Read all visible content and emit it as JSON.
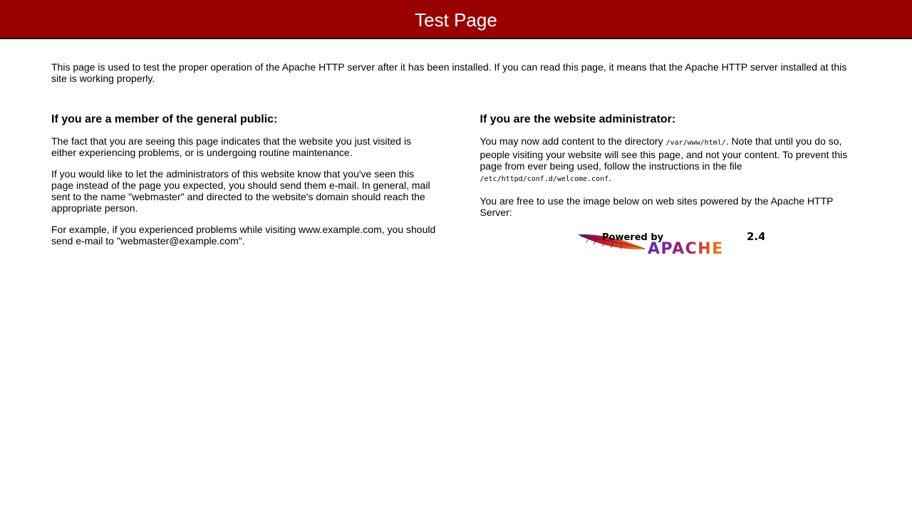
{
  "header": {
    "title": "Test Page"
  },
  "intro": "This page is used to test the proper operation of the Apache HTTP server after it has been installed. If you can read this page, it means that the Apache HTTP server installed at this site is working properly.",
  "public": {
    "heading": "If you are a member of the general public:",
    "p1": "The fact that you are seeing this page indicates that the website you just visited is either experiencing problems, or is undergoing routine maintenance.",
    "p2": "If you would like to let the administrators of this website know that you've seen this page instead of the page you expected, you should send them e-mail. In general, mail sent to the name \"webmaster\" and directed to the website's domain should reach the appropriate person.",
    "p3": "For example, if you experienced problems while visiting www.example.com, you should send e-mail to \"webmaster@example.com\"."
  },
  "admin": {
    "heading": "If you are the website administrator:",
    "p1_a": "You may now add content to the directory ",
    "p1_code1": "/var/www/html/",
    "p1_b": ". Note that until you do so, people visiting your website will see this page, and not your content. To prevent this page from ever being used, follow the instructions in the file ",
    "p1_code2": "/etc/httpd/conf.d/welcome.conf",
    "p1_c": ".",
    "p2": "You are free to use the image below on web sites powered by the Apache HTTP Server:"
  },
  "badge": {
    "powered_by": "Powered by",
    "version": "2.4",
    "name": "APACHE"
  },
  "colors": {
    "header_bg": "#990000",
    "header_text": "#ffffff",
    "apache_purple": "#5b2ca8",
    "apache_orange": "#f08c1e",
    "feather_red": "#c8102e"
  }
}
